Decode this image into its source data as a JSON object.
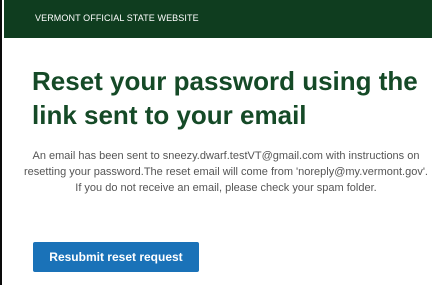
{
  "header": {
    "banner_text": "VERMONT OFFICIAL STATE WEBSITE"
  },
  "main": {
    "title": "Reset your password using the link sent to your email",
    "message": "An email has been sent to sneezy.dwarf.testVT@gmail.com with instructions on resetting your password.The reset email will come from 'noreply@my.vermont.gov'. If you do not receive an email, please check your spam folder.",
    "resubmit_label": "Resubmit reset request"
  },
  "colors": {
    "banner_background": "#0f3d1f",
    "title_text": "#154a27",
    "button_background": "#1a72b8"
  }
}
